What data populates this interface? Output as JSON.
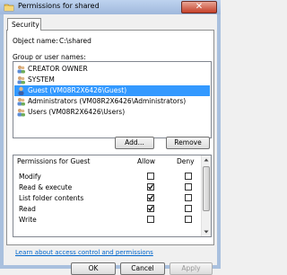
{
  "window": {
    "title": "Permissions for shared",
    "close_glyph": "✕"
  },
  "tabs": [
    {
      "label": "Security"
    }
  ],
  "object": {
    "label": "Object name:",
    "value": "C:\\shared"
  },
  "users": {
    "label": "Group or user names:",
    "items": [
      {
        "label": "CREATOR OWNER",
        "icon": "group-icon",
        "selected": false
      },
      {
        "label": "SYSTEM",
        "icon": "group-icon",
        "selected": false
      },
      {
        "label": "Guest (VM08R2X6426\\Guest)",
        "icon": "user-icon",
        "selected": true
      },
      {
        "label": "Administrators (VM08R2X6426\\Administrators)",
        "icon": "group-icon",
        "selected": false
      },
      {
        "label": "Users (VM08R2X6426\\Users)",
        "icon": "group-icon",
        "selected": false
      }
    ],
    "add_label": "Add...",
    "remove_label": "Remove"
  },
  "permissions": {
    "header": "Permissions for Guest",
    "allow_label": "Allow",
    "deny_label": "Deny",
    "rows": [
      {
        "name": "Modify",
        "allow": false,
        "deny": false
      },
      {
        "name": "Read & execute",
        "allow": true,
        "deny": false
      },
      {
        "name": "List folder contents",
        "allow": true,
        "deny": false
      },
      {
        "name": "Read",
        "allow": true,
        "deny": false
      },
      {
        "name": "Write",
        "allow": false,
        "deny": false
      }
    ]
  },
  "link": "Learn about access control and permissions",
  "footer": {
    "ok": "OK",
    "cancel": "Cancel",
    "apply": "Apply"
  },
  "colors": {
    "selection": "#3399ff",
    "link": "#0066cc",
    "title_bar": "#a9c0de"
  }
}
